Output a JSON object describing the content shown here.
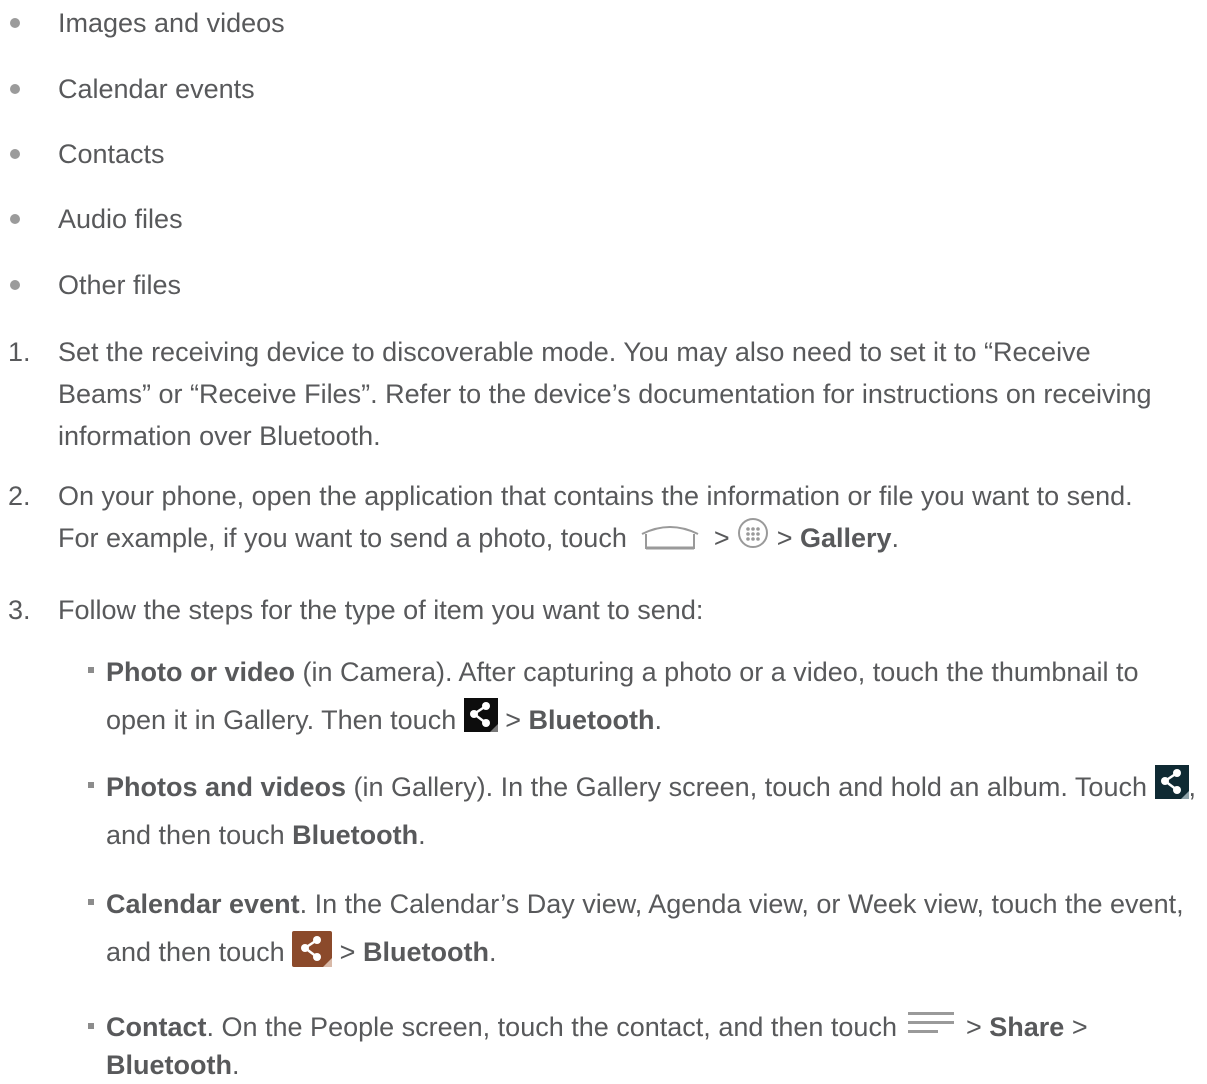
{
  "bullets": [
    "Images and videos",
    "Calendar events",
    "Contacts",
    "Audio files",
    "Other files"
  ],
  "steps": {
    "s1": {
      "num": "1.",
      "text": "Set the receiving device to discoverable mode. You may also need to set it to “Receive Beams” or “Receive Files”. Refer to the device’s documentation for instructions on receiving information over Bluetooth."
    },
    "s2": {
      "num": "2.",
      "text_a": "On your phone, open the application that contains the information or file you want to send. For example, if you want to send a photo, touch",
      "sep1": ">",
      "sep2": ">",
      "gallery": "Gallery",
      "end": "."
    },
    "s3": {
      "num": "3.",
      "text": "Follow the steps for the type of item you want to send:"
    }
  },
  "sub": {
    "photo": {
      "bold": "Photo or video",
      "text_a": " (in Camera). After capturing a photo or a video, touch the thumbnail to open it in Gallery. Then touch",
      "sep": " >",
      "bluetooth": "Bluetooth",
      "end": "."
    },
    "photos": {
      "bold": "Photos and videos",
      "text_a": " (in Gallery). In the Gallery screen, touch and hold an album. Touch",
      "text_b": ", and then touch",
      "bluetooth": "Bluetooth",
      "end": "."
    },
    "calendar": {
      "bold": "Calendar event",
      "text_a": ". In the Calendar’s Day view, Agenda view, or Week view, touch the event, and then touch",
      "sep": " >",
      "bluetooth": "Bluetooth",
      "end": "."
    },
    "contact": {
      "bold": "Contact",
      "text_a": ". On the People screen, touch the contact, and then touch",
      "sep": " >",
      "share": "Share",
      "sep2": " >",
      "bluetooth": "Bluetooth",
      "end": "."
    }
  },
  "icons": {
    "home": "home-icon",
    "apps": "apps-icon",
    "share": "share-icon",
    "menu": "menu-icon"
  },
  "colors": {
    "text": "#58595b",
    "share_dark": "#0d0d0d",
    "share_navy": "#0f2a33",
    "share_brown": "#8b4a2b"
  }
}
